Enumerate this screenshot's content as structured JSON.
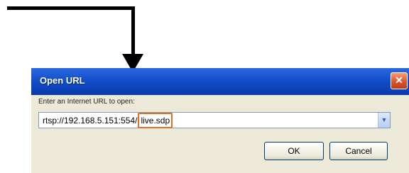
{
  "dialog": {
    "title": "Open URL",
    "close_glyph": "✕",
    "prompt": "Enter an Internet URL to open:",
    "url_base": "rtsp://192.168.5.151:554/",
    "url_path": "live.sdp",
    "dropdown_glyph": "▼",
    "ok_label": "OK",
    "cancel_label": "Cancel"
  },
  "annotation": {
    "arrow_color": "#000000",
    "highlight_color": "#e07020"
  },
  "icons": [
    "close-icon",
    "chevron-down-icon",
    "annotation-arrow"
  ]
}
